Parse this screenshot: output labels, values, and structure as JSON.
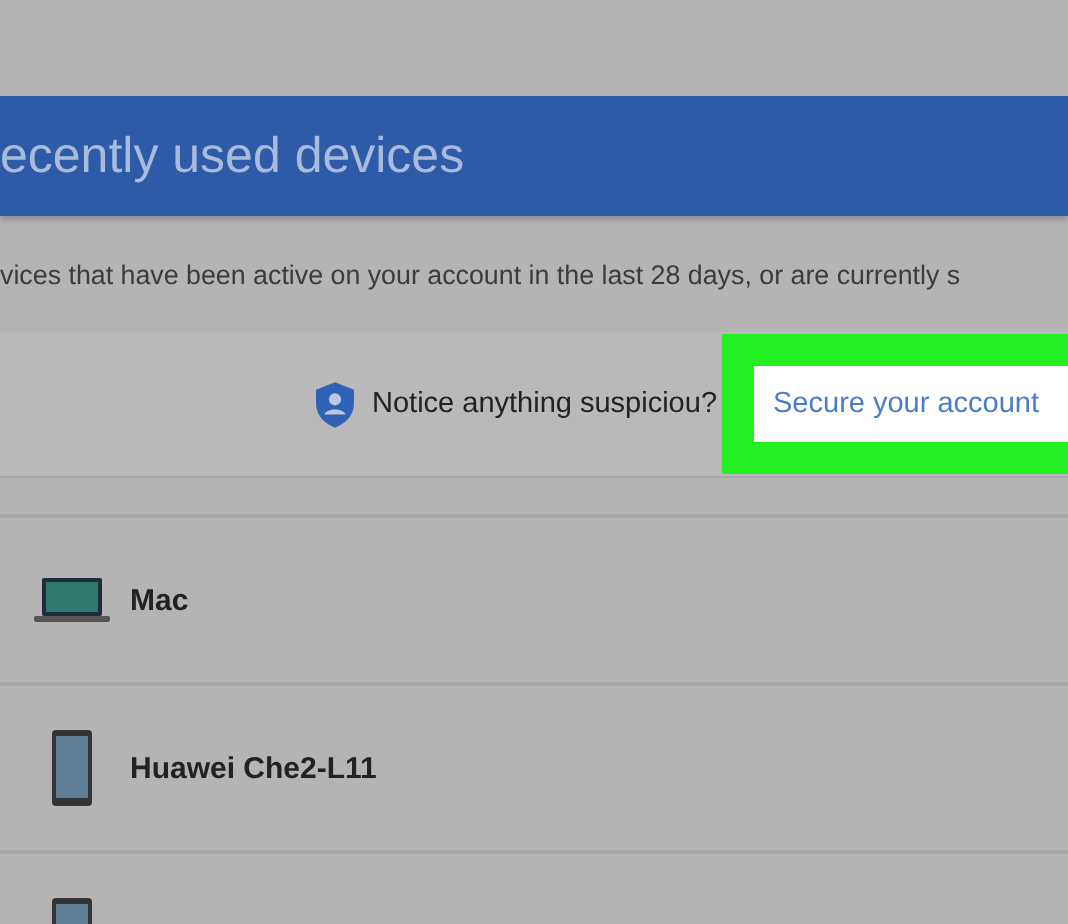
{
  "header": {
    "title": "ecently used devices"
  },
  "description": "vices that have been active on your account in the last 28 days, or are currently s",
  "notice": {
    "text": "Notice anything suspiciou",
    "mark": "?",
    "link": "Secure your account",
    "highlighted": true
  },
  "devices": [
    {
      "kind": "laptop",
      "name": "Mac"
    },
    {
      "kind": "phone",
      "name": "Huawei Che2-L11"
    },
    {
      "kind": "phone"
    }
  ]
}
